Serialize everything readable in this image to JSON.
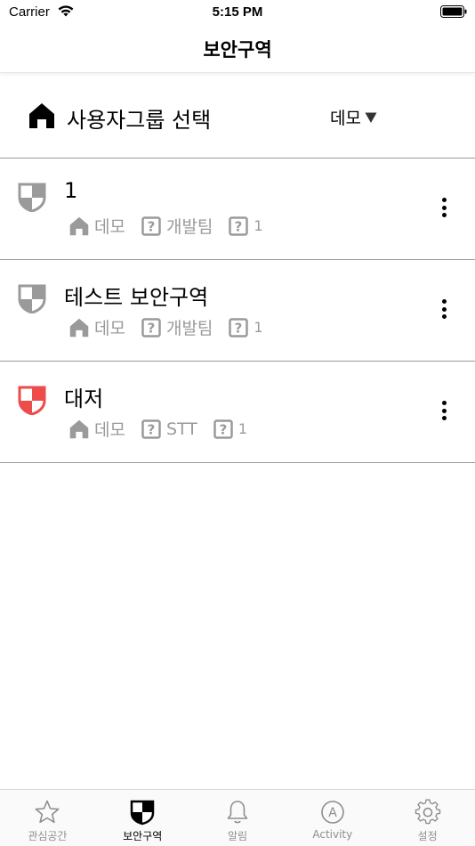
{
  "status_bar": {
    "carrier": "Carrier",
    "time": "5:15 PM"
  },
  "nav": {
    "title": "보안구역"
  },
  "group_select": {
    "label": "사용자그룹 선택",
    "selected": "데모"
  },
  "zones": [
    {
      "name": "1",
      "group": "데모",
      "team": "개발팀",
      "count": "1",
      "shield_color": "#9a9a9a"
    },
    {
      "name": "테스트 보안구역",
      "group": "데모",
      "team": "개발팀",
      "count": "1",
      "shield_color": "#9a9a9a"
    },
    {
      "name": "대저",
      "group": "데모",
      "team": "STT",
      "count": "1",
      "shield_color": "#ee4b4b"
    }
  ],
  "tabs": [
    {
      "label": "관심공간",
      "icon": "star-icon",
      "active": false
    },
    {
      "label": "보안구역",
      "icon": "shield-icon",
      "active": true
    },
    {
      "label": "알림",
      "icon": "bell-icon",
      "active": false
    },
    {
      "label": "Activity",
      "icon": "activity-icon",
      "active": false
    },
    {
      "label": "설정",
      "icon": "gear-icon",
      "active": false
    }
  ]
}
